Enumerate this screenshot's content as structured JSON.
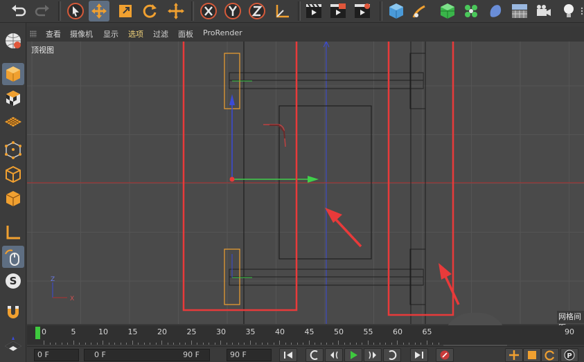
{
  "menu": {
    "items": [
      {
        "label": "查看",
        "active": false
      },
      {
        "label": "摄像机",
        "active": false
      },
      {
        "label": "显示",
        "active": false
      },
      {
        "label": "选项",
        "active": true
      },
      {
        "label": "过滤",
        "active": false
      },
      {
        "label": "面板",
        "active": false
      },
      {
        "label": "ProRender",
        "active": false
      }
    ]
  },
  "viewport": {
    "label": "顶视图",
    "grid_spacing_label": "网格间距",
    "axis": {
      "z": "Z",
      "x": "X"
    }
  },
  "timeline": {
    "current_frame": 0,
    "ticks": [
      "0",
      "5",
      "10",
      "15",
      "20",
      "25",
      "30",
      "35",
      "40",
      "45",
      "50",
      "55",
      "60",
      "65"
    ],
    "end_label": "90"
  },
  "bottom": {
    "current_frame_field": "0 F",
    "min_frame_field": "0 F",
    "range_end_field": "90 F",
    "max_frame_field": "90 F"
  },
  "toolbar_icons": [
    "undo-icon",
    "redo-icon",
    "select-icon",
    "move-icon",
    "scale-icon",
    "rotate-icon",
    "live-select-icon",
    "x-axis-icon",
    "y-axis-icon",
    "z-axis-icon",
    "coordinate-system-icon",
    "render-view-icon",
    "render-picture-viewer-icon",
    "render-settings-icon",
    "cube-icon",
    "pen-icon",
    "subdivision-icon",
    "cloner-icon",
    "deformer-icon",
    "floor-icon",
    "camera-icon",
    "light-icon"
  ],
  "colors": {
    "accent_orange": "#f0a030",
    "highlight_red": "#e83a3a",
    "axis_blue": "#3b4bd8",
    "axis_green": "#3fd04a",
    "selection_blue": "#5e6e82",
    "timeline_green": "#3ec93e"
  }
}
